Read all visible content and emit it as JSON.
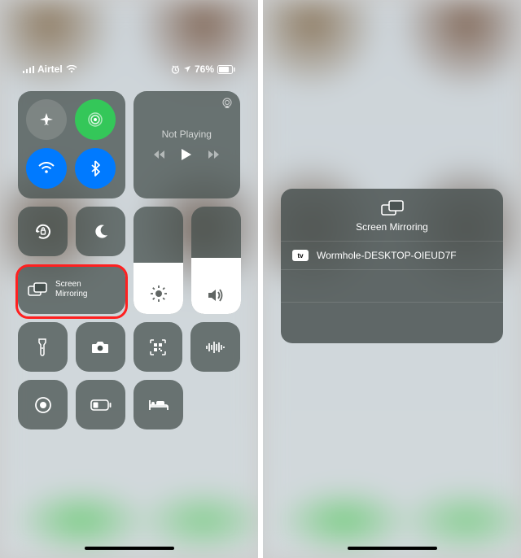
{
  "status": {
    "carrier": "Airtel",
    "battery_percent": "76%"
  },
  "media": {
    "now_playing_label": "Not Playing"
  },
  "controls": {
    "screen_mirroring_label": "Screen\nMirroring"
  },
  "mirror_panel": {
    "title": "Screen Mirroring",
    "devices": [
      {
        "name": "Wormhole-DESKTOP-OIEUD7F",
        "type_badge": "tv"
      }
    ]
  },
  "sliders": {
    "brightness_fill_pct": 48,
    "volume_fill_pct": 52
  }
}
